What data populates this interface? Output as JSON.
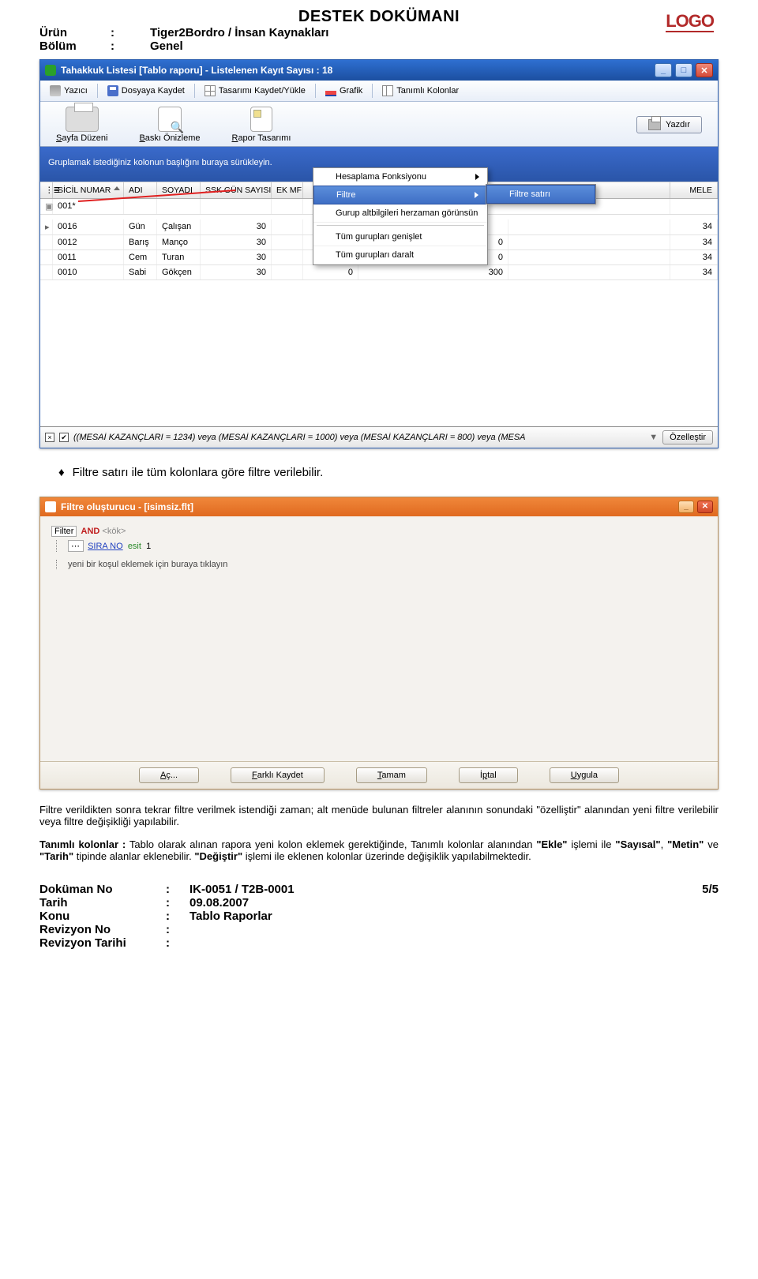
{
  "header": {
    "doc_title": "DESTEK DOKÜMANI",
    "urun_label": "Ürün",
    "urun_value": "Tiger2Bordro / İnsan Kaynakları",
    "bolum_label": "Bölüm",
    "bolum_value": "Genel",
    "logo": "LOGO"
  },
  "win1": {
    "title": "Tahakkuk Listesi [Tablo raporu]  -  Listelenen Kayıt Sayısı : 18",
    "toolbar": {
      "yazici": "Yazıcı",
      "dosyaya": "Dosyaya Kaydet",
      "tasarimi": "Tasarımı Kaydet/Yükle",
      "grafik": "Grafik",
      "tanimli": "Tanımlı Kolonlar"
    },
    "bigbtns": {
      "sayfa": "Sayfa Düzeni",
      "baski": "Baskı Önizleme",
      "rapor": "Rapor Tasarımı",
      "yazdir": "Yazdır"
    },
    "groupbar": "Gruplamak istediğiniz kolonun başlığını buraya sürükleyin.",
    "cols": {
      "sicil": "SİCİL NUMAR",
      "adi": "ADI",
      "soyadi": "SOYADI",
      "ssk": "SSK GÜN SAYISI",
      "ek": "EK MF",
      "mele": "MELE"
    },
    "filter_value": "001*",
    "rows": [
      {
        "sicil": "0016",
        "adi": "Gün",
        "soyadi": "Çalışan",
        "ssk": "30",
        "v2": "",
        "v3": "",
        "mele": "34"
      },
      {
        "sicil": "0012",
        "adi": "Barış",
        "soyadi": "Manço",
        "ssk": "30",
        "v2": "",
        "v3": "0",
        "mele": "34"
      },
      {
        "sicil": "0011",
        "adi": "Cem",
        "soyadi": "Turan",
        "ssk": "30",
        "v2": "",
        "v3": "0",
        "mele": "34"
      },
      {
        "sicil": "0010",
        "adi": "Sabi",
        "soyadi": "Gökçen",
        "ssk": "30",
        "v2": "0",
        "v3": "300",
        "mele": "34"
      }
    ],
    "ctx": {
      "fonksiyon": "Hesaplama Fonksiyonu",
      "filtre": "Filtre",
      "filtre_satiri": "Filtre satırı",
      "alt": "Gurup altbilgileri herzaman görünsün",
      "genislet": "Tüm gurupları genişlet",
      "daralt": "Tüm gurupları daralt"
    },
    "status_expr": "((MESAİ KAZANÇLARI = 1234) veya (MESAİ KAZANÇLARI = 1000) veya (MESAİ KAZANÇLARI = 800) veya (MESA",
    "customize": "Özelleştir"
  },
  "body": {
    "bullet1": "Filtre satırı ile tüm kolonlara göre filtre verilebilir.",
    "para1": "Filtre verildikten sonra tekrar filtre verilmek istendiği zaman; alt menüde bulunan filtreler alanının sonundaki \"özelliştir\" alanından yeni filtre verilebilir veya filtre değişikliği yapılabilir.",
    "para2_prefix": "Tanımlı kolonlar :",
    "para2_body": " Tablo olarak alınan rapora yeni kolon eklemek gerektiğinde, Tanımlı kolonlar alanından ",
    "para2_b1": "\"Ekle\"",
    "para2_m1": " işlemi ile ",
    "para2_b2": "\"Sayısal\"",
    "para2_m2": ", ",
    "para2_b3": "\"Metin\"",
    "para2_m3": " ve ",
    "para2_b4": "\"Tarih\"",
    "para2_m4": " tipinde alanlar eklenebilir. ",
    "para2_b5": "\"Değiştir\"",
    "para2_end": " işlemi ile eklenen kolonlar üzerinde değişiklik yapılabilmektedir."
  },
  "win2": {
    "title": "Filtre oluşturucu - [isimsiz.flt]",
    "filter_lbl": "Filter",
    "and": "AND",
    "root": "<kök>",
    "sira": "SIRA NO",
    "esit": "esit",
    "one": "1",
    "hint": "yeni bir koşul eklemek için buraya tıklayın",
    "btns": {
      "ac": "Aç...",
      "farkli": "Farklı Kaydet",
      "tamam": "Tamam",
      "iptal": "İptal",
      "uygula": "Uygula"
    }
  },
  "footer": {
    "dokuman_no_l": "Doküman No",
    "dokuman_no_v": "IK-0051  / T2B-0001",
    "tarih_l": "Tarih",
    "tarih_v": "09.08.2007",
    "konu_l": "Konu",
    "konu_v": "Tablo Raporlar",
    "rev_no_l": "Revizyon No",
    "rev_tarih_l": "Revizyon Tarihi",
    "page": "5/5"
  }
}
